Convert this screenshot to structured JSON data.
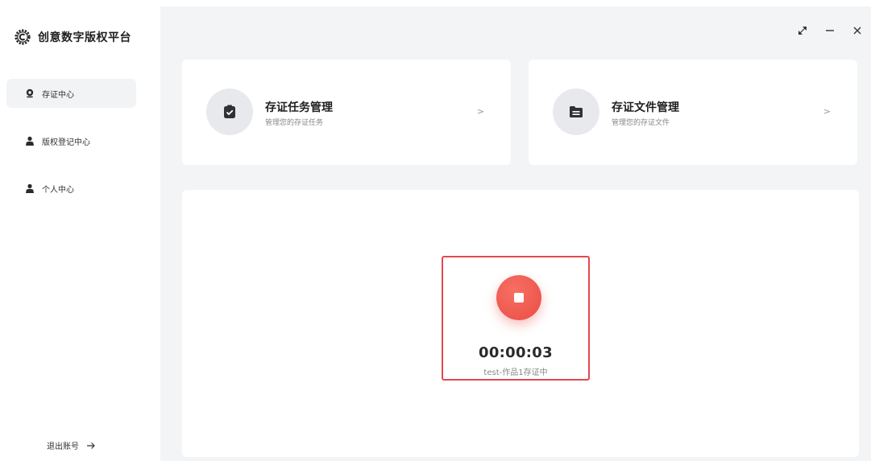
{
  "brand": {
    "title": "创意数字版权平台",
    "logo_icon": "gear-c-logo-icon"
  },
  "sidebar": {
    "items": [
      {
        "label": "存证中心",
        "icon": "badge-icon",
        "active": true
      },
      {
        "label": "版权登记中心",
        "icon": "user-icon",
        "active": false
      },
      {
        "label": "个人中心",
        "icon": "user-icon",
        "active": false
      }
    ],
    "logout_label": "退出账号",
    "logout_icon": "arrow-right-icon"
  },
  "window_controls": [
    "restore-icon",
    "minimize-icon",
    "close-icon"
  ],
  "cards": {
    "task": {
      "title": "存证任务管理",
      "subtitle": "管理您的存证任务",
      "chevron": ">",
      "icon": "clipboard-check-icon"
    },
    "file": {
      "title": "存证文件管理",
      "subtitle": "管理您的存证文件",
      "chevron": ">",
      "icon": "folder-icon"
    }
  },
  "recorder": {
    "timer": "00:00:03",
    "status": "test-作品1存证中",
    "accent_color": "#e5474d"
  },
  "colors": {
    "accent": "#ea4d44",
    "background": "#f3f4f6",
    "active_nav": "#f2f3f5"
  }
}
